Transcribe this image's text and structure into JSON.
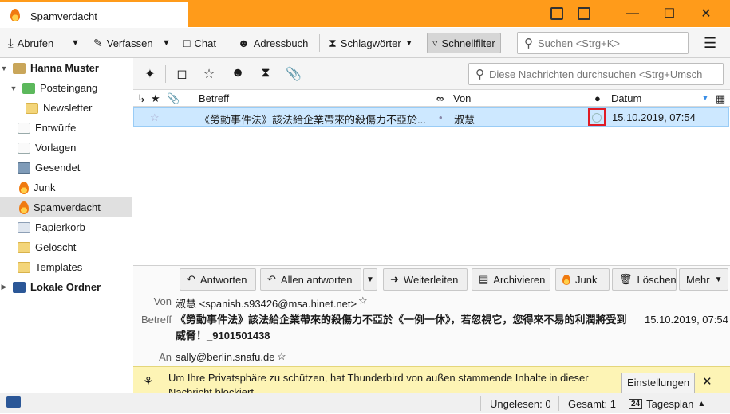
{
  "tab": {
    "title": "Spamverdacht"
  },
  "toolbar": {
    "fetch": "Abrufen",
    "compose": "Verfassen",
    "chat": "Chat",
    "addressbook": "Adressbuch",
    "tags": "Schlagwörter",
    "quickfilter": "Schnellfilter",
    "search_placeholder": "Suchen <Strg+K>"
  },
  "folders": {
    "account": "Hanna Muster",
    "items": [
      "Posteingang",
      "Newsletter",
      "Entwürfe",
      "Vorlagen",
      "Gesendet",
      "Junk",
      "Spamverdacht",
      "Papierkorb",
      "Gelöscht",
      "Templates"
    ],
    "local": "Lokale Ordner"
  },
  "quickfilter": {
    "search_placeholder": "Diese Nachrichten durchsuchen <Strg+Umsch"
  },
  "columns": {
    "subject": "Betreff",
    "from": "Von",
    "date": "Datum"
  },
  "message": {
    "subject": "《勞動事件法》該法給企業帶來的殺傷力不亞於...",
    "from": "淑慧",
    "date": "15.10.2019, 07:54"
  },
  "actions": {
    "reply": "Antworten",
    "reply_all": "Allen antworten",
    "forward": "Weiterleiten",
    "archive": "Archivieren",
    "junk": "Junk",
    "delete": "Löschen",
    "more": "Mehr"
  },
  "header": {
    "from_label": "Von",
    "from_value": "淑慧 <spanish.s93426@msa.hinet.net>",
    "subject_label": "Betreff",
    "subject_value": "《勞動事件法》該法給企業帶來的殺傷力不亞於《一例一休》，若忽視它，您得來不易的利潤將受到威脅！_9101501438",
    "date": "15.10.2019, 07:54",
    "to_label": "An",
    "to_value": "sally@berlin.snafu.de"
  },
  "notification": {
    "text": "Um Ihre Privatsphäre zu schützen, hat Thunderbird von außen stammende Inhalte in dieser Nachricht blockiert.",
    "button": "Einstellungen"
  },
  "status": {
    "unread": "Ungelesen: 0",
    "total": "Gesamt: 1",
    "calendar_day": "24",
    "today_pane": "Tagesplan"
  },
  "colors": {
    "titlebar": "#ff9b1a",
    "selection": "#cde8ff",
    "highlight": "#e01b24",
    "notification": "#fdf4b5"
  }
}
